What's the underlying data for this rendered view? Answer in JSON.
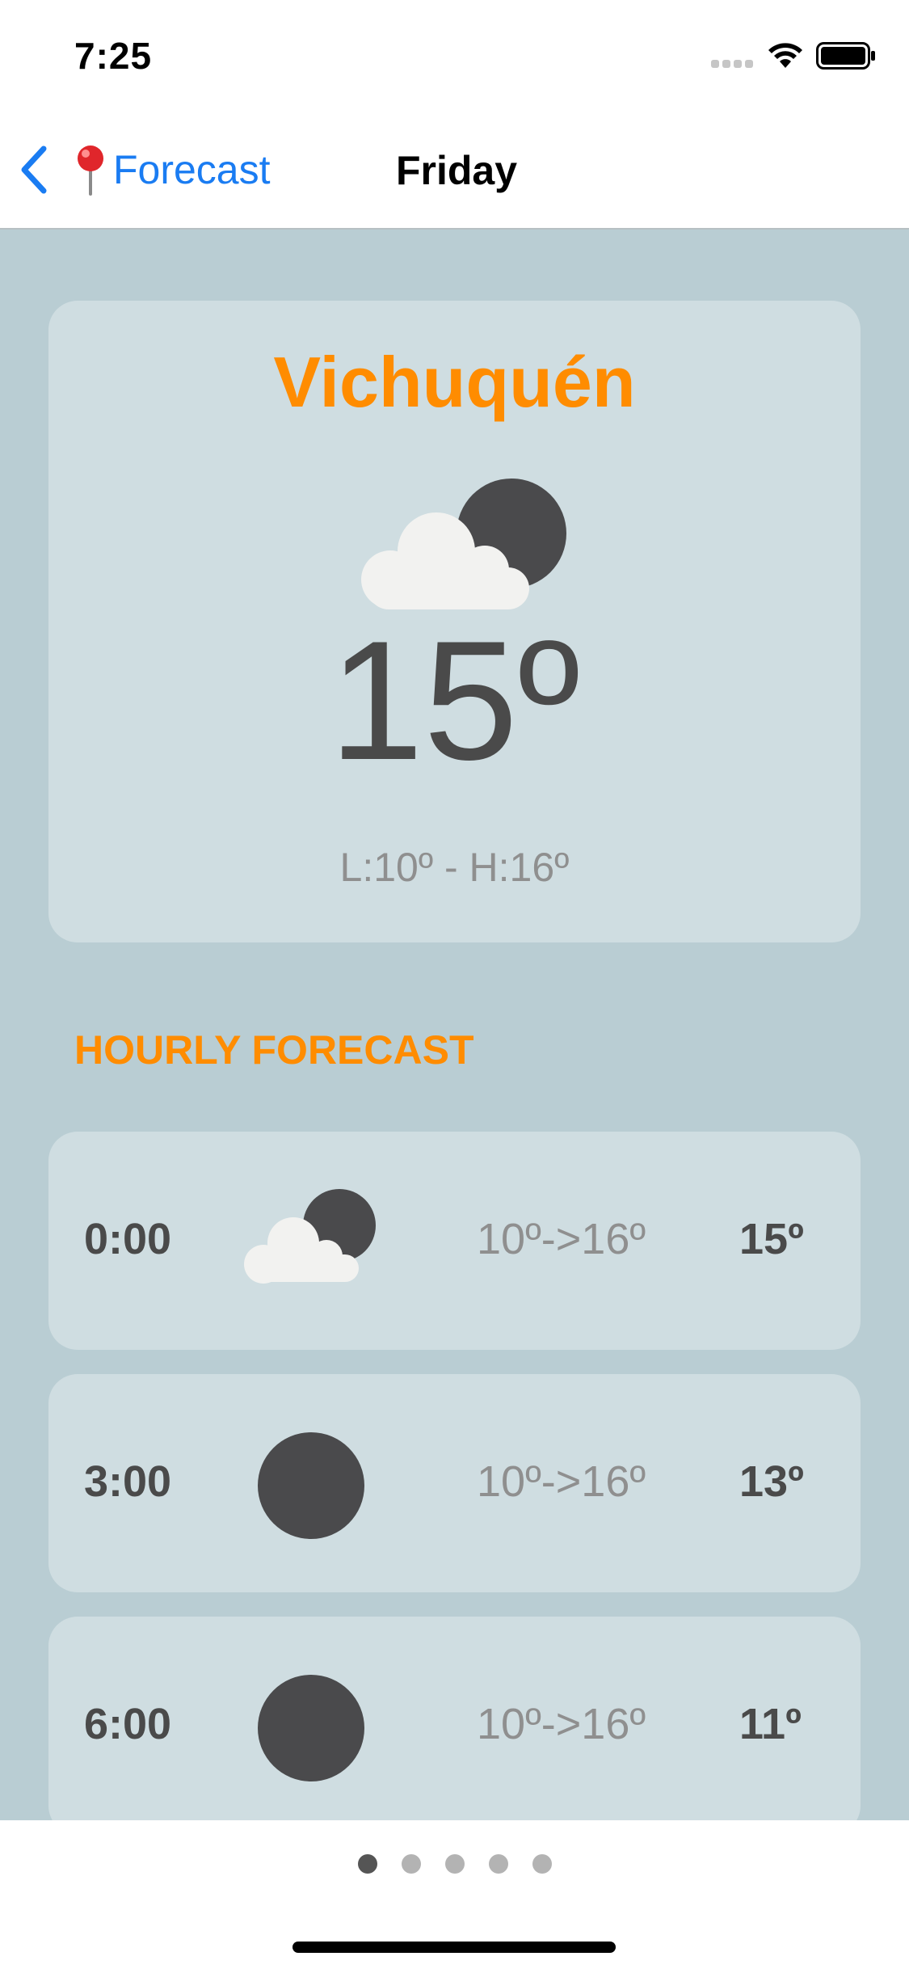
{
  "status_bar": {
    "time": "7:25"
  },
  "nav": {
    "back_label": "Forecast",
    "title": "Friday"
  },
  "current": {
    "city": "Vichuquén",
    "condition_icon": "partly-cloudy-night-icon",
    "temperature": "15º",
    "range": "L:10º - H:16º"
  },
  "hourly": {
    "header": "HOURLY FORECAST",
    "rows": [
      {
        "time": "0:00",
        "icon": "partly-cloudy-night-icon",
        "range": "10º->16º",
        "temp": "15º"
      },
      {
        "time": "3:00",
        "icon": "clear-night-moon-icon",
        "range": "10º->16º",
        "temp": "13º"
      },
      {
        "time": "6:00",
        "icon": "clear-night-moon-icon",
        "range": "10º->16º",
        "temp": "11º"
      }
    ]
  },
  "pager": {
    "count": 5,
    "active_index": 0
  },
  "colors": {
    "accent": "#ff8c00",
    "link": "#1a7cf2",
    "background": "#b9cdd3",
    "card": "#cfdde1",
    "temp_text": "#4a4a4a",
    "muted_text": "#8f8f8f"
  }
}
